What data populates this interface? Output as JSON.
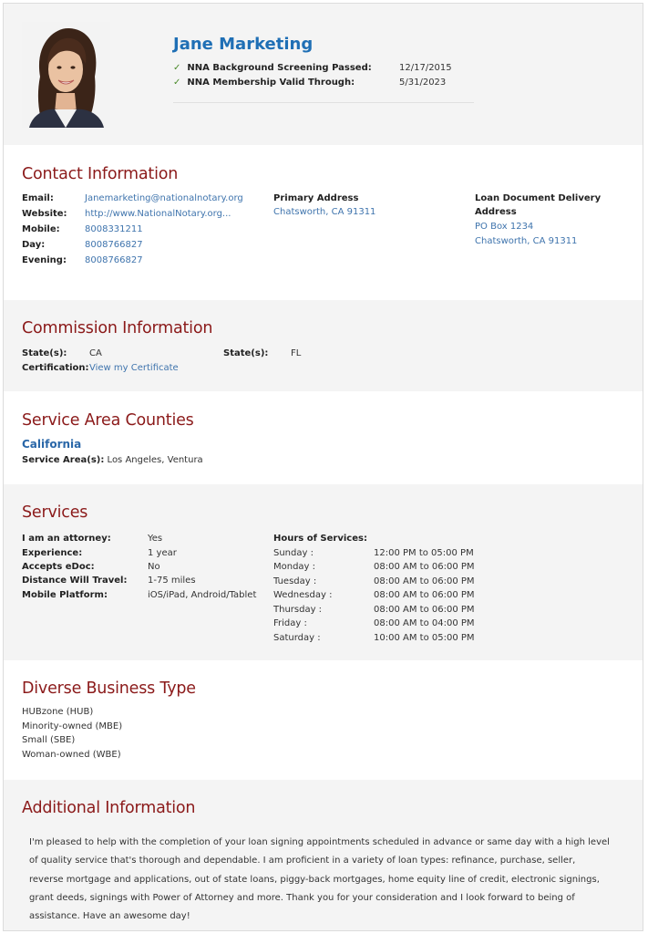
{
  "profile": {
    "name": "Jane Marketing",
    "checks": [
      {
        "label": "NNA Background Screening Passed:",
        "value": "12/17/2015"
      },
      {
        "label": "NNA Membership Valid Through:",
        "value": "5/31/2023"
      }
    ]
  },
  "contact": {
    "title": "Contact Information",
    "fields": [
      {
        "label": "Email:",
        "value": "Janemarketing@nationalnotary.org"
      },
      {
        "label": "Website:",
        "value": "http://www.NationalNotary.org..."
      },
      {
        "label": "Mobile:",
        "value": "8008331211"
      },
      {
        "label": "Day:",
        "value": "8008766827"
      },
      {
        "label": "Evening:",
        "value": "8008766827"
      }
    ],
    "primary_address_label": "Primary Address",
    "primary_address": "Chatsworth, CA 91311",
    "delivery_label_1": "Loan Document Delivery",
    "delivery_label_2": "Address",
    "delivery_line_1": "PO Box 1234",
    "delivery_line_2": "Chatsworth, CA 91311"
  },
  "commission": {
    "title": "Commission Information",
    "state_label_1": "State(s):",
    "state_value_1": "CA",
    "state_label_2": "State(s):",
    "state_value_2": "FL",
    "cert_label": "Certification:",
    "cert_link": "View my Certificate"
  },
  "service_area": {
    "title": "Service Area Counties",
    "state": "California",
    "label": "Service Area(s):",
    "value": "Los Angeles, Ventura"
  },
  "services": {
    "title": "Services",
    "fields": [
      {
        "label": "I am an attorney:",
        "value": "Yes"
      },
      {
        "label": "Experience:",
        "value": "1 year"
      },
      {
        "label": "Accepts eDoc:",
        "value": "No"
      },
      {
        "label": "Distance Will Travel:",
        "value": "1-75 miles"
      },
      {
        "label": "Mobile Platform:",
        "value": "iOS/iPad, Android/Tablet"
      }
    ],
    "hours_label": "Hours of Services:",
    "hours": [
      {
        "day": "Sunday :",
        "time": "12:00 PM to 05:00 PM"
      },
      {
        "day": "Monday :",
        "time": "08:00 AM to 06:00 PM"
      },
      {
        "day": "Tuesday :",
        "time": "08:00 AM to 06:00 PM"
      },
      {
        "day": "Wednesday :",
        "time": "08:00 AM to 06:00 PM"
      },
      {
        "day": "Thursday :",
        "time": "08:00 AM to 06:00 PM"
      },
      {
        "day": "Friday :",
        "time": "08:00 AM to 04:00 PM"
      },
      {
        "day": "Saturday :",
        "time": "10:00 AM to 05:00 PM"
      }
    ]
  },
  "diverse": {
    "title": "Diverse Business Type",
    "items": [
      "HUBzone (HUB)",
      "Minority-owned (MBE)",
      "Small (SBE)",
      "Woman-owned (WBE)"
    ]
  },
  "additional": {
    "title": "Additional Information",
    "text": "I'm pleased to help with the completion of your loan signing appointments scheduled in advance or same day with a high level of quality service that's thorough and dependable. I am proficient in a variety of loan types: refinance, purchase, seller, reverse mortgage and applications, out of state loans, piggy-back mortgages, home equity line of credit, electronic signings, grant deeds, signings with Power of Attorney and more. Thank you for your consideration and I look forward to being of assistance. Have an awesome day!"
  },
  "colors": {
    "section_title": "#8b1a1a",
    "name": "#1f6fb5",
    "link": "#3f74ad",
    "check": "#4a8a2a",
    "grey_band": "#f4f4f4"
  },
  "icons": {
    "check": "check-icon",
    "photo": "profile-photo"
  }
}
